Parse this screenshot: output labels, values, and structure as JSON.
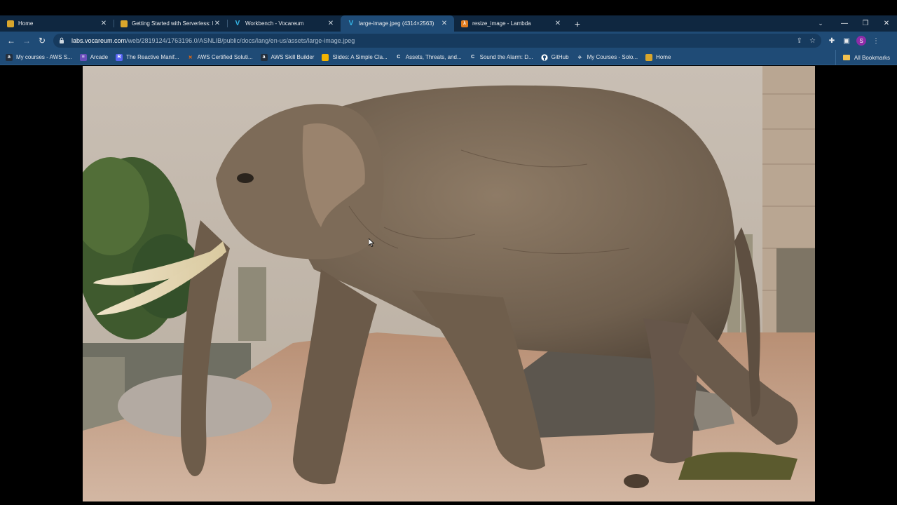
{
  "browser": {
    "tabs": [
      {
        "title": "Home",
        "icon": "package-icon",
        "active": false
      },
      {
        "title": "Getting Started with Serverless: L",
        "icon": "package-icon",
        "active": false
      },
      {
        "title": "Workbench - Vocareum",
        "icon": "vocareum-icon",
        "active": false
      },
      {
        "title": "large-image.jpeg (4314×2563)",
        "icon": "vocareum-icon",
        "active": true
      },
      {
        "title": "resize_image - Lambda",
        "icon": "lambda-icon",
        "active": false
      }
    ],
    "new_tab": "+",
    "address": {
      "host": "labs.vocareum.com",
      "path": "/web/2819124/1763196.0/ASNLIB/public/docs/lang/en-us/assets/large-image.jpeg"
    },
    "profile_initial": "S",
    "bookmarks": [
      {
        "label": "My courses - AWS S...",
        "icon": "aws-icon",
        "color": "#232f3e"
      },
      {
        "label": "Arcade",
        "icon": "arcade-icon",
        "color": "#6b4fbb"
      },
      {
        "label": "The Reactive Manif...",
        "icon": "reactive-icon",
        "color": "#5865f2"
      },
      {
        "label": "AWS Certified Soluti...",
        "icon": "credly-icon",
        "color": "#ff6b00"
      },
      {
        "label": "AWS Skill Builder",
        "icon": "aws-icon",
        "color": "#232f3e"
      },
      {
        "label": "Slides: A Simple Cla...",
        "icon": "slides-icon",
        "color": "#f4b400"
      },
      {
        "label": "Assets, Threats, and...",
        "icon": "coursera-icon",
        "color": "#1f4b76"
      },
      {
        "label": "Sound the Alarm: D...",
        "icon": "coursera-icon",
        "color": "#1f4b76"
      },
      {
        "label": "GitHub",
        "icon": "github-icon",
        "color": "#1f4b76"
      },
      {
        "label": "My Courses - Solo...",
        "icon": "solo-icon",
        "color": "#1f4b76"
      },
      {
        "label": "Home",
        "icon": "package-icon",
        "color": "#d9a62c"
      }
    ],
    "all_bookmarks": "All Bookmarks"
  },
  "page": {
    "image_description_alt": "large-image.jpeg"
  }
}
